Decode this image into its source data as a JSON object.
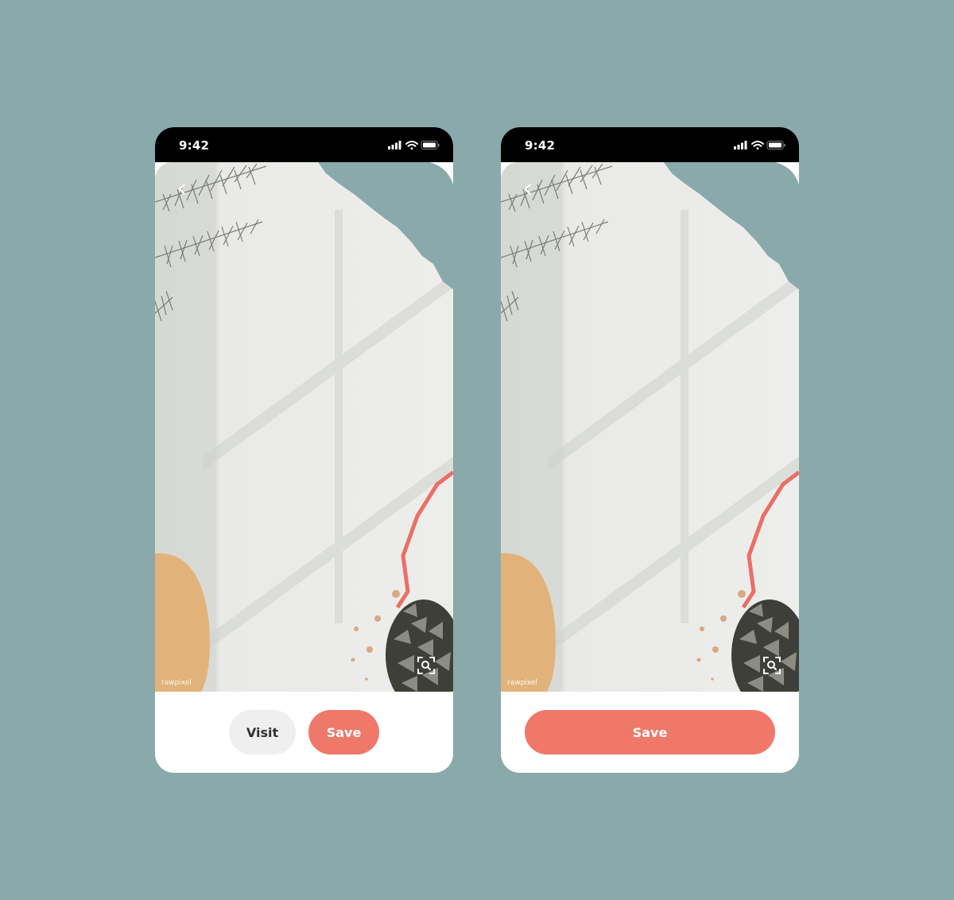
{
  "screens": [
    {
      "status_bar": {
        "time": "9:42"
      },
      "image": {
        "watermark": "rawpixel"
      },
      "actions": {
        "visit_label": "Visit",
        "save_label": "Save"
      }
    },
    {
      "status_bar": {
        "time": "9:42"
      },
      "image": {
        "watermark": "rawpixel"
      },
      "actions": {
        "save_label": "Save"
      }
    }
  ],
  "icons": {
    "back": "chevron-left-icon",
    "visual_search": "visual-search-icon",
    "signal": "cellular-signal-icon",
    "wifi": "wifi-icon",
    "battery": "battery-icon"
  },
  "colors": {
    "background": "#8aa9ab",
    "primary": "#ef786a",
    "secondary_button": "#efefef",
    "status_bar": "#000000"
  }
}
